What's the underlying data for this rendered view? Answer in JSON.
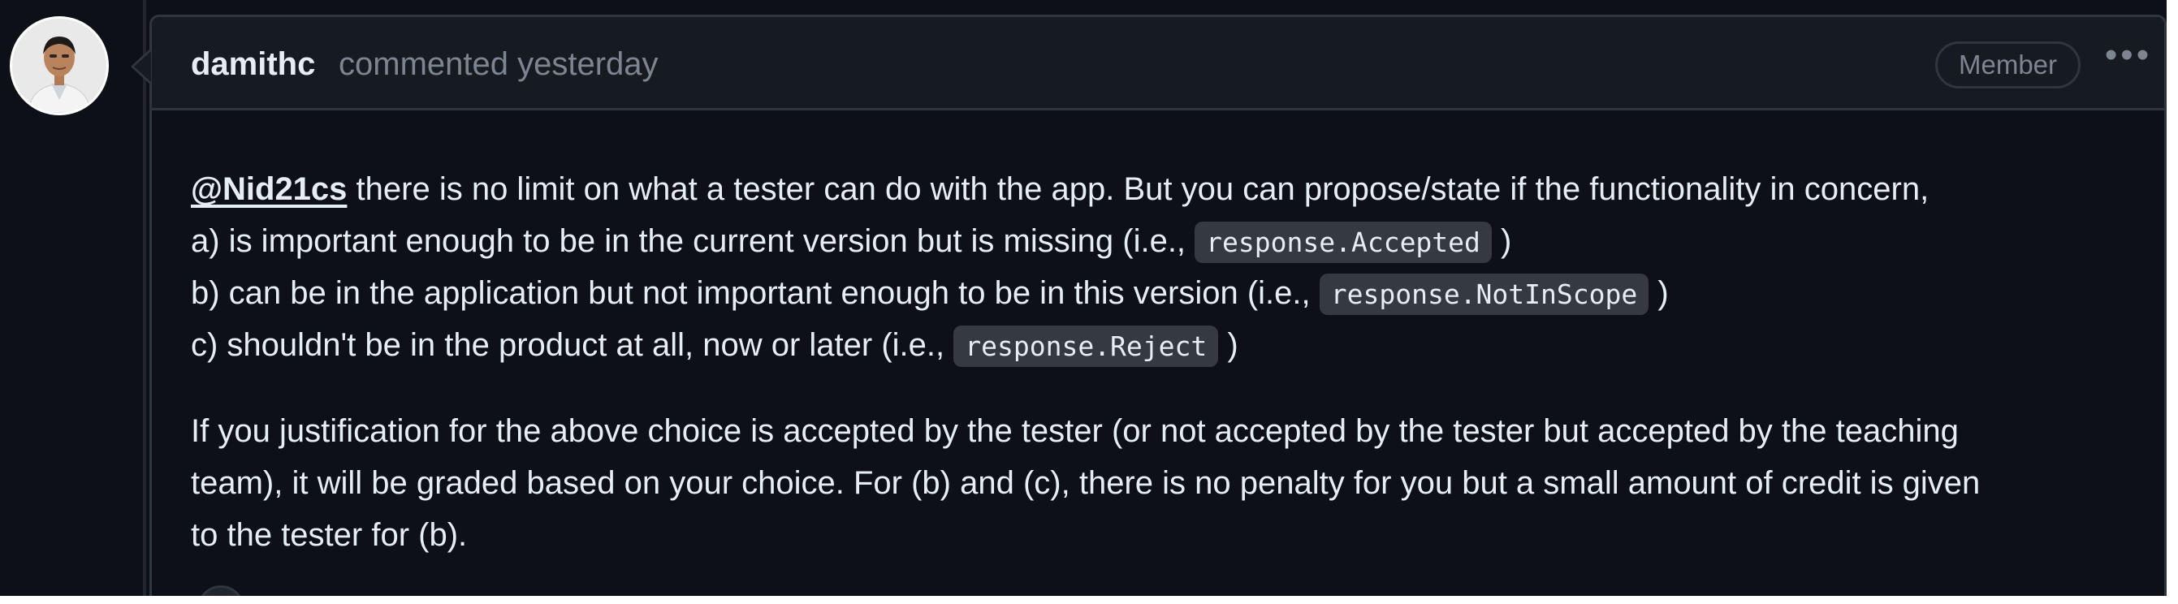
{
  "comment": {
    "author": "damithc",
    "meta": "commented yesterday",
    "role": "Member",
    "menu_label": "•••",
    "body": {
      "mention": "@Nid21cs",
      "line1_rest": " there is no limit on what a tester can do with the app. But you can propose/state if the functionality in concern,",
      "items": [
        {
          "prefix": "a) is important enough to be in the current version but is missing (i.e., ",
          "code": "response.Accepted",
          "suffix": " )"
        },
        {
          "prefix": "b) can be in the application but not important enough to be in this version (i.e., ",
          "code": "response.NotInScope",
          "suffix": " )"
        },
        {
          "prefix": "c) shouldn't be in the product at all, now or later (i.e., ",
          "code": "response.Reject",
          "suffix": " )"
        }
      ],
      "paragraph2": [
        "If you justification for the above choice is accepted by the tester (or not accepted by the tester but accepted by the teaching",
        "team), it will be graded based on your choice. For (b) and (c), there is no penalty for you but a small amount of credit is given",
        "to the tester for (b)."
      ]
    }
  },
  "colors": {
    "background": "#0d1117",
    "header_bg": "#161b22",
    "border": "#30363d",
    "text": "#e6edf3",
    "muted": "#7d8590",
    "code_bg": "#343942"
  }
}
